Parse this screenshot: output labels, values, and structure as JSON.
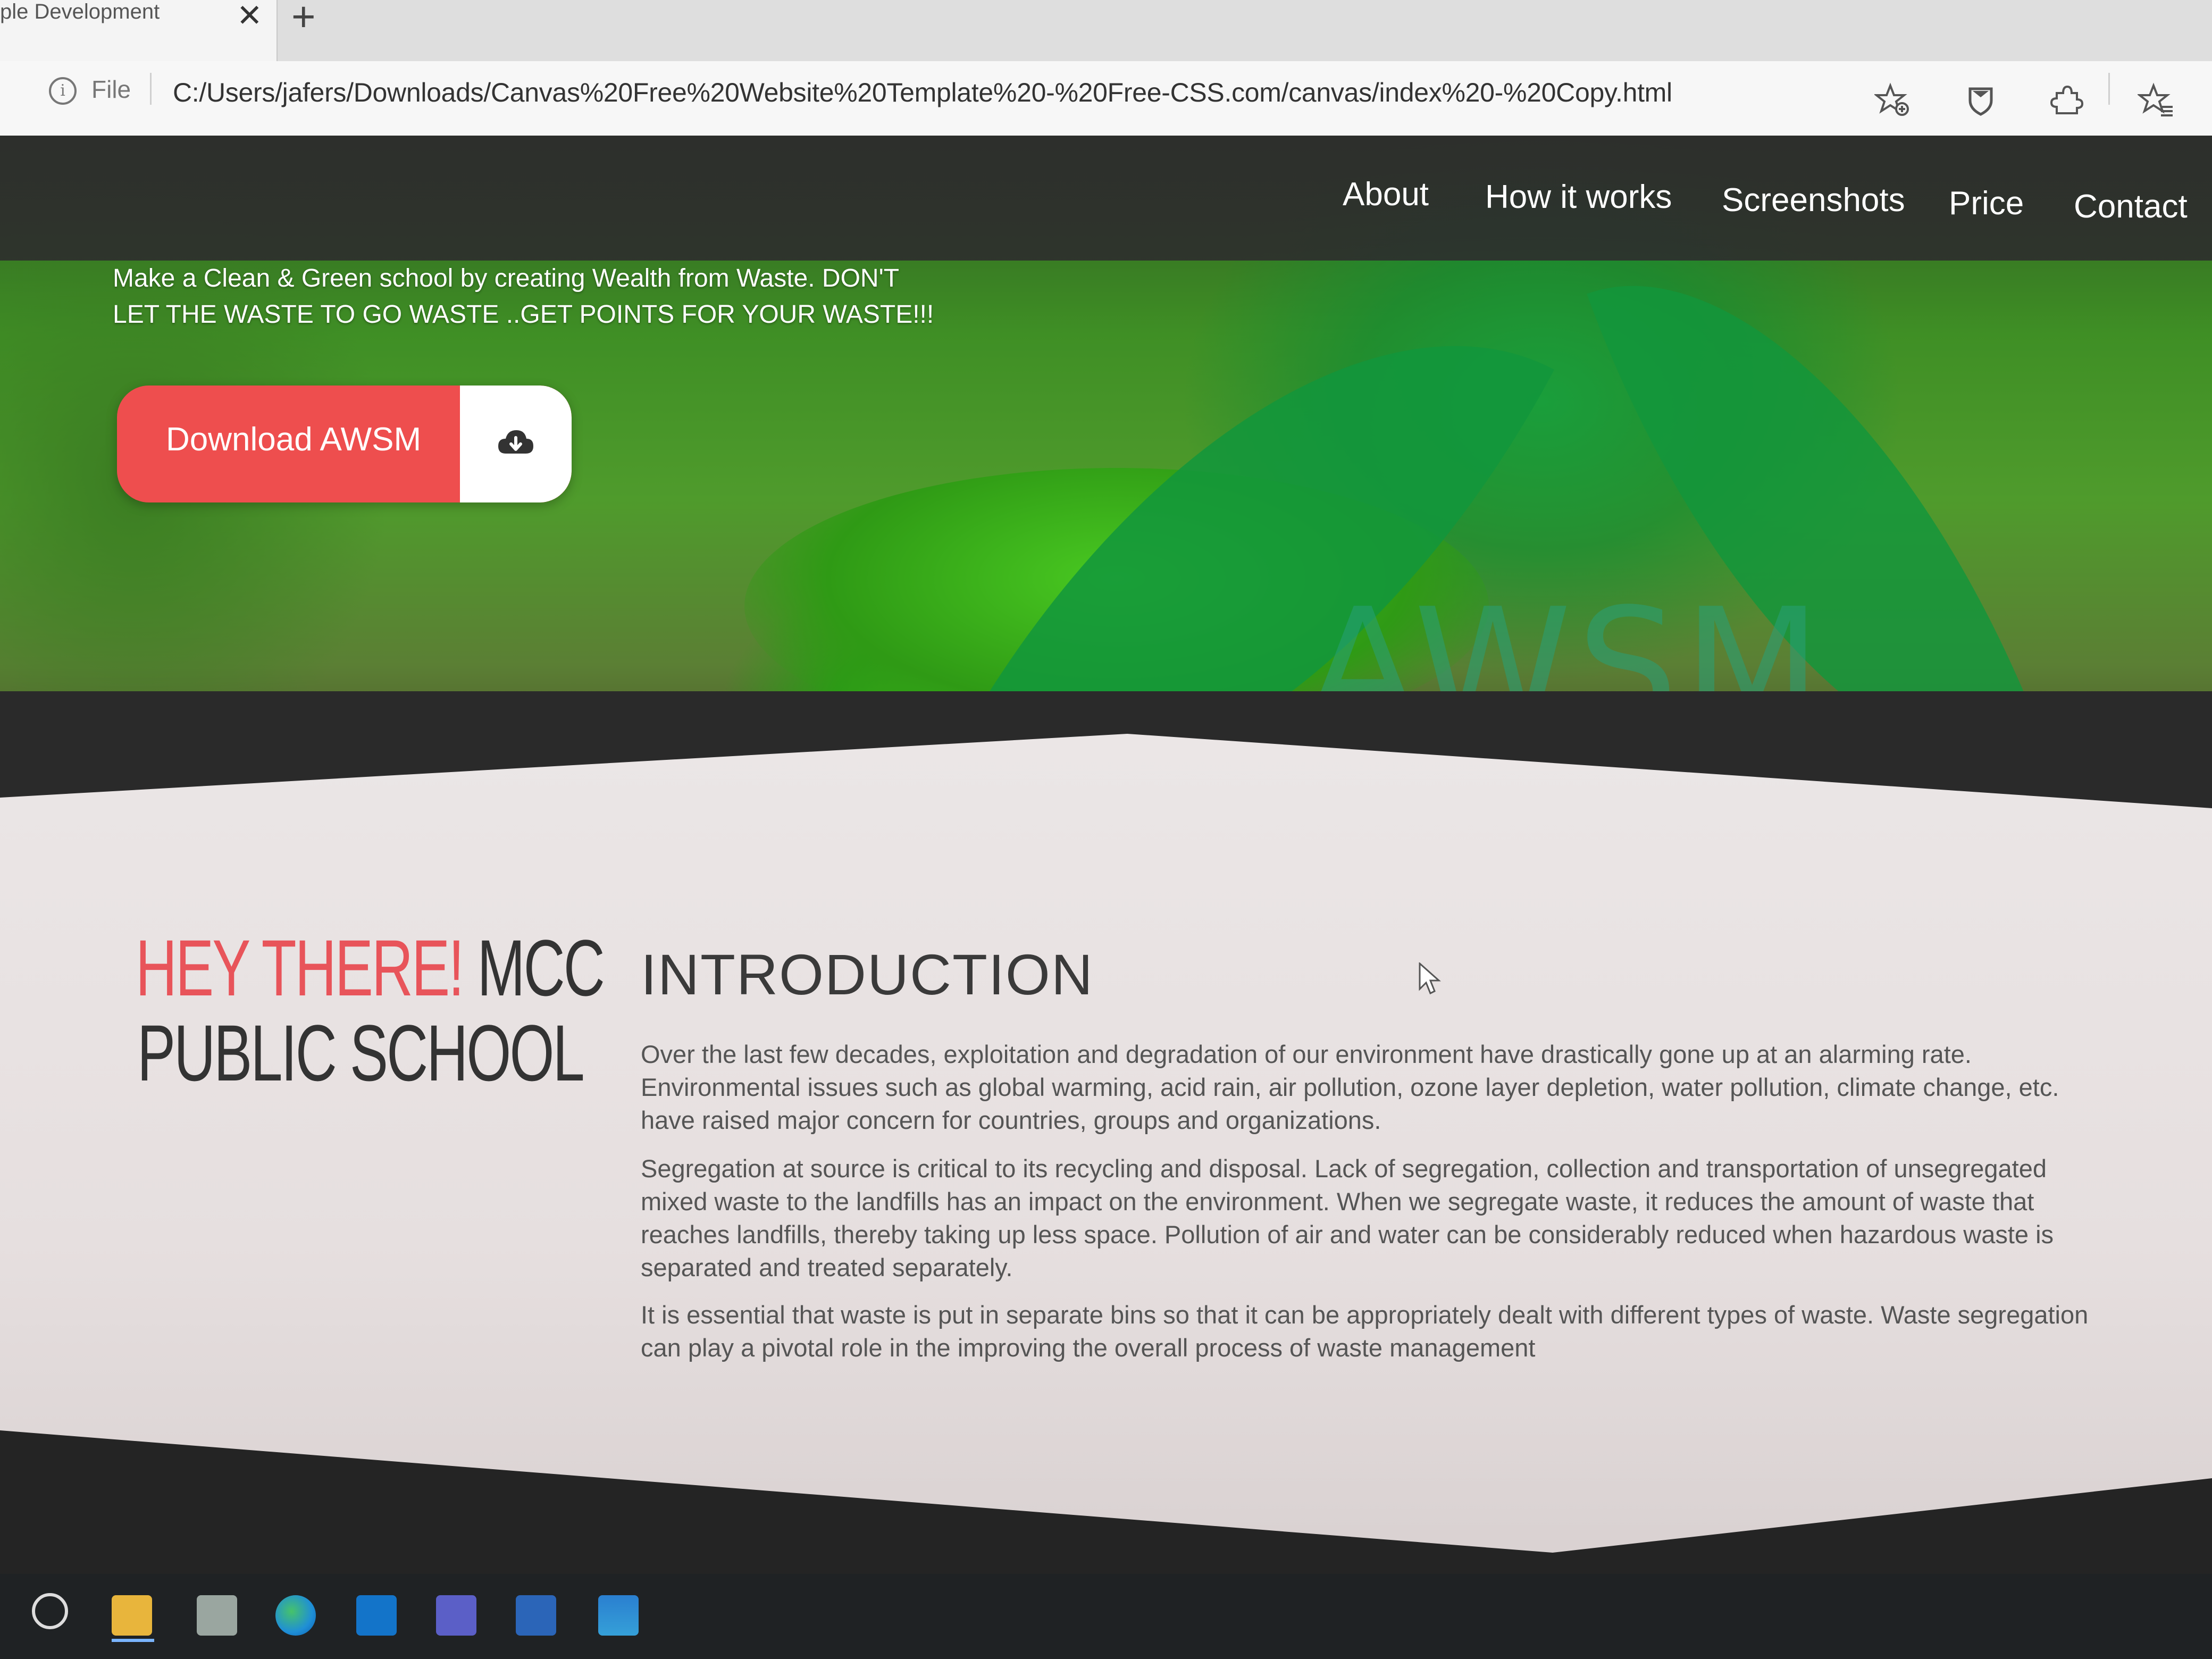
{
  "browser": {
    "tab_title": "ple Development",
    "tab_close": "✕",
    "new_tab": "+",
    "file_label": "File",
    "url": "C:/Users/jafers/Downloads/Canvas%20Free%20Website%20Template%20-%20Free-CSS.com/canvas/index%20-%20Copy.html",
    "toolbar_icons": [
      "add-favorite-icon",
      "shield-icon",
      "extensions-icon",
      "favorites-icon"
    ]
  },
  "nav": {
    "items": [
      "About",
      "How it works",
      "Screenshots",
      "Price",
      "Contact"
    ]
  },
  "hero": {
    "line1": "Make a Clean & Green school by creating Wealth from Waste. DON'T",
    "line2": "LET THE WASTE TO GO WASTE ..GET POINTS FOR YOUR WASTE!!!",
    "download_label": "Download AWSM",
    "download_icon": "cloud-download-icon",
    "watermark": "AWSM"
  },
  "intro": {
    "hey_red": "HEY THERE!",
    "hey_dark": "MCC",
    "school": "PUBLIC SCHOOL",
    "heading": "INTRODUCTION",
    "paragraphs": [
      "Over the last few decades, exploitation and degradation of our environment have drastically gone up at an alarming rate. Environmental issues such as global warming, acid rain, air pollution, ozone layer depletion, water pollution, climate change, etc. have raised major concern for countries, groups and organizations.",
      "Segregation at source is critical to its recycling and disposal. Lack of segregation, collection and transportation of unsegregated mixed waste to the landfills has an impact on the environment. When we segregate waste, it reduces the amount of waste that reaches landfills, thereby taking up less space. Pollution of air and water can be considerably reduced when hazardous waste is separated and treated separately.",
      "It is essential that waste is put in separate bins so that it can be appropriately dealt with different types of waste. Waste segregation can play a pivotal role in the improving the overall process of waste management"
    ]
  },
  "taskbar": {
    "icons": [
      "search-circle-icon",
      "file-explorer-icon",
      "app-icon",
      "edge-icon",
      "outlook-icon",
      "teams-icon",
      "word-icon",
      "photos-icon"
    ]
  },
  "colors": {
    "accent_red": "#ee4e4e",
    "heading_red": "#e8545a",
    "nav_band": "#2d2d2d",
    "hero_green": "#3f8f25"
  }
}
